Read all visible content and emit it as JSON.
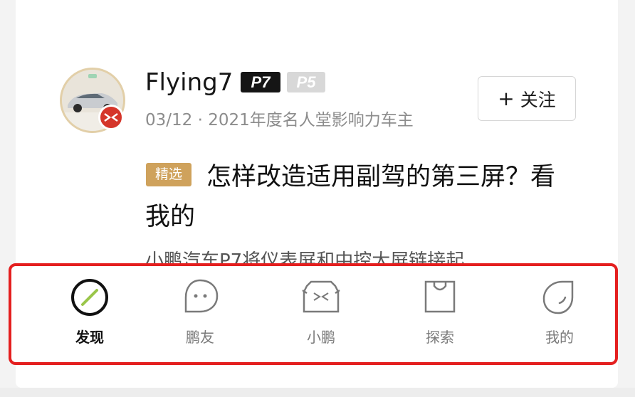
{
  "post": {
    "username": "Flying7",
    "tags": [
      "P7",
      "P5"
    ],
    "meta": "03/12 · 2021年度名人堂影响力车主",
    "follow_label": "关注",
    "featured_badge": "精选",
    "title": "怎样改造适用副驾的第三屏？看我的",
    "excerpt": "小鹏汽车P7将仪表屏和中控大屏链接起"
  },
  "nav": {
    "items": [
      {
        "label": "发现",
        "icon": "discover-icon",
        "active": true
      },
      {
        "label": "鹏友",
        "icon": "chat-bubble-icon",
        "active": false
      },
      {
        "label": "小鹏",
        "icon": "car-front-icon",
        "active": false
      },
      {
        "label": "探索",
        "icon": "shopping-bag-icon",
        "active": false
      },
      {
        "label": "我的",
        "icon": "profile-leaf-icon",
        "active": false
      }
    ],
    "highlight_color": "#e41f1f",
    "accent_color": "#9ac64a"
  }
}
